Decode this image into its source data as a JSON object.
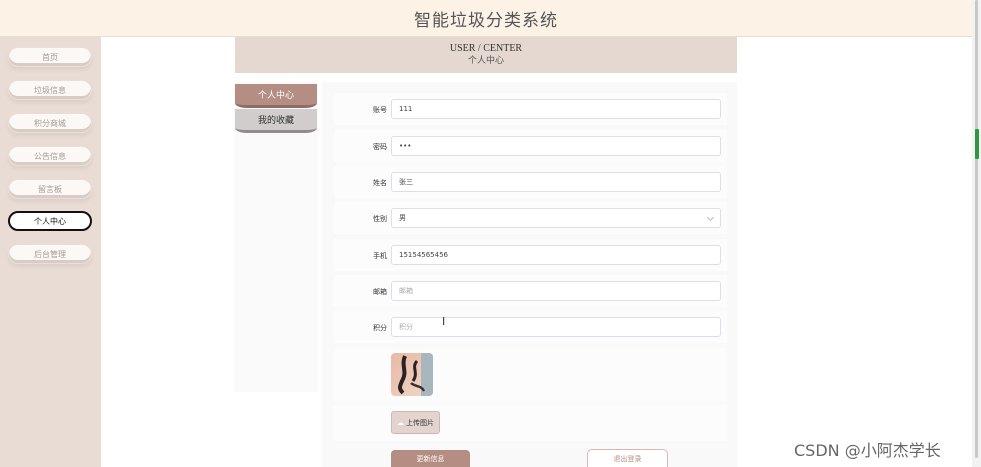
{
  "header": {
    "title": "智能垃圾分类系统"
  },
  "sidebar": {
    "items": [
      {
        "label": "首页"
      },
      {
        "label": "垃圾信息"
      },
      {
        "label": "积分商城"
      },
      {
        "label": "公告信息"
      },
      {
        "label": "留言板"
      },
      {
        "label": "个人中心",
        "active": true
      },
      {
        "label": "后台管理"
      }
    ]
  },
  "banner": {
    "en": "USER / CENTER",
    "cn": "个人中心"
  },
  "tabs": [
    {
      "label": "个人中心",
      "active": true
    },
    {
      "label": "我的收藏"
    }
  ],
  "form": {
    "fields": [
      {
        "label": "账号",
        "value": "111"
      },
      {
        "label": "密码",
        "value": "•••"
      },
      {
        "label": "姓名",
        "value": "张三"
      },
      {
        "label": "性别",
        "value": "男"
      },
      {
        "label": "手机",
        "value": "15154565456"
      },
      {
        "label": "邮箱",
        "placeholder": "邮箱"
      },
      {
        "label": "积分",
        "placeholder": "积分"
      }
    ],
    "upload_label": "上传图片",
    "update_label": "更新信息",
    "logout_label": "退出登录"
  },
  "colors": {
    "accent": "#b58e83",
    "sidebar_bg": "#e8dcd4",
    "header_bg": "#fcf3e6"
  },
  "watermark": "CSDN @小阿杰学长"
}
